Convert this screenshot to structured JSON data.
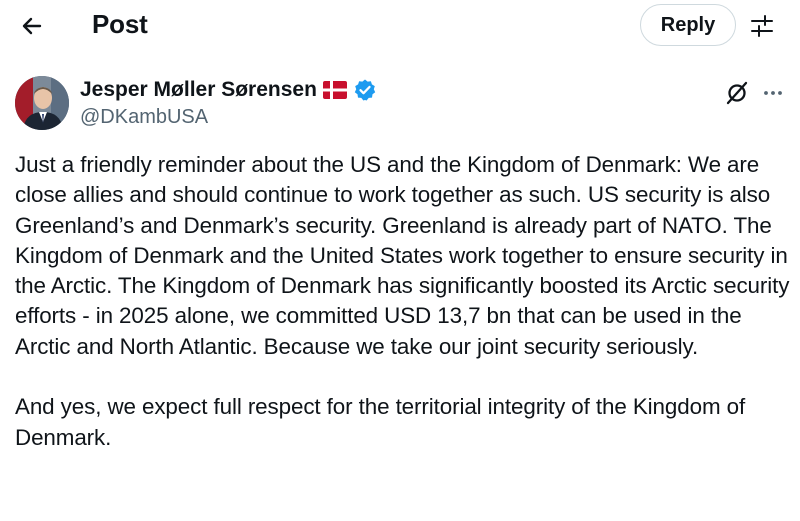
{
  "header": {
    "back_icon": "arrow-left-icon",
    "title": "Post",
    "reply_label": "Reply",
    "filter_icon": "sliders-icon"
  },
  "post": {
    "author_name": "Jesper Møller Sørensen",
    "flag_icon": "denmark-flag-icon",
    "verified_icon": "verified-badge-icon",
    "handle": "@DKambUSA",
    "grok_icon": "grok-icon",
    "more_icon": "more-horizontal-icon",
    "paragraphs": [
      "Just a friendly reminder about the US and the Kingdom of Denmark: We are close allies and should continue to work together as such. US security is also Greenland’s and Denmark’s security. Greenland is already part of NATO. The Kingdom of Denmark and the United States work together to ensure security in the Arctic. The Kingdom of Denmark has significantly boosted its Arctic security efforts - in 2025 alone, we committed USD 13,7 bn that can be used in the Arctic and North Atlantic. Because we take our joint security seriously.",
      "And yes, we expect full respect for the territorial integrity of the Kingdom of Denmark."
    ]
  },
  "colors": {
    "text": "#0f1419",
    "secondary_text": "#536471",
    "verified_blue": "#1d9bf0",
    "flag_red": "#c8102e",
    "border": "#cfd9de"
  }
}
